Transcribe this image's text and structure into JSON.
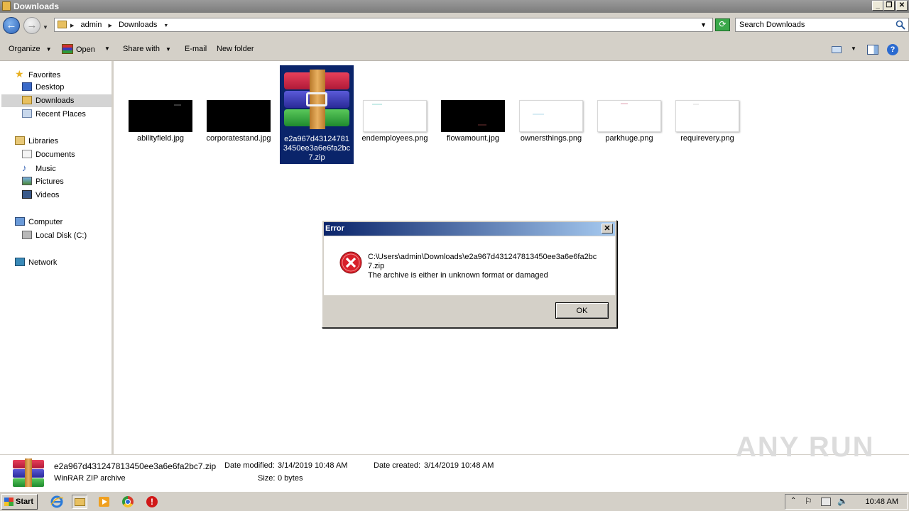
{
  "window": {
    "title": "Downloads"
  },
  "address": {
    "crumbs": [
      "admin",
      "Downloads"
    ]
  },
  "search": {
    "placeholder": "Search Downloads"
  },
  "toolbar": {
    "organize": "Organize",
    "open": "Open",
    "share_with": "Share with",
    "email": "E-mail",
    "new_folder": "New folder"
  },
  "nav": {
    "favorites": "Favorites",
    "desktop": "Desktop",
    "downloads": "Downloads",
    "recent_places": "Recent Places",
    "libraries": "Libraries",
    "documents": "Documents",
    "music": "Music",
    "pictures": "Pictures",
    "videos": "Videos",
    "computer": "Computer",
    "local_disk": "Local Disk (C:)",
    "network": "Network"
  },
  "files": [
    {
      "name": "abilityfield.jpg"
    },
    {
      "name": "corporatestand.jpg"
    },
    {
      "name": "e2a967d431247813450ee3a6e6fa2bc7.zip"
    },
    {
      "name": "endemployees.png"
    },
    {
      "name": "flowamount.jpg"
    },
    {
      "name": "ownersthings.png"
    },
    {
      "name": "parkhuge.png"
    },
    {
      "name": "requirevery.png"
    }
  ],
  "dialog": {
    "title": "Error",
    "path": "C:\\Users\\admin\\Downloads\\e2a967d431247813450ee3a6e6fa2bc7.zip",
    "message": "The archive is either in unknown format or damaged",
    "ok": "OK"
  },
  "details": {
    "filename": "e2a967d431247813450ee3a6e6fa2bc7.zip",
    "type": "WinRAR ZIP archive",
    "modified_label": "Date modified:",
    "modified_value": "3/14/2019 10:48 AM",
    "created_label": "Date created:",
    "created_value": "3/14/2019 10:48 AM",
    "size_label": "Size:",
    "size_value": "0 bytes"
  },
  "watermark": "ANY RUN",
  "taskbar": {
    "start": "Start",
    "clock": "10:48 AM"
  }
}
